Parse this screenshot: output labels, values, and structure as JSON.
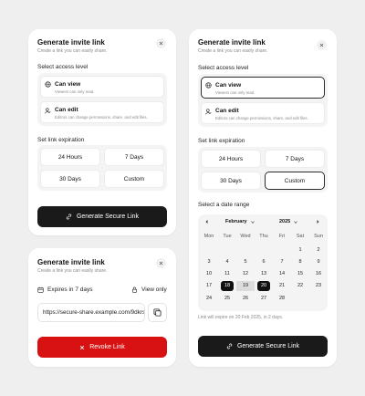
{
  "card1": {
    "title": "Generate invite link",
    "subtitle": "Create a link you can easily share.",
    "access_label": "Select access level",
    "options": [
      {
        "title": "Can view",
        "desc": "Viewers can only read."
      },
      {
        "title": "Can edit",
        "desc": "Editors can change permissions, share, and edit files."
      }
    ],
    "expiration_label": "Set link expiration",
    "durations": [
      "24 Hours",
      "7 Days",
      "30 Days",
      "Custom"
    ],
    "generate_label": "Generate Secure Link"
  },
  "card2": {
    "title": "Generate invite link",
    "subtitle": "Create a link you can easily share.",
    "expires": "Expires in 7 days",
    "permission": "View only",
    "url": "https://secure-share.example.com/9dkrs",
    "revoke_label": "Revoke Link"
  },
  "card3": {
    "title": "Generate invite link",
    "subtitle": "Create a link you can easily share.",
    "access_label": "Select access level",
    "options": [
      {
        "title": "Can view",
        "desc": "Viewers can only read."
      },
      {
        "title": "Can edit",
        "desc": "Editors can change permissions, share, and edit files."
      }
    ],
    "expiration_label": "Set link expiration",
    "durations": [
      "24 Hours",
      "7 Days",
      "30 Days",
      "Custom"
    ],
    "date_range_label": "Select a date range",
    "calendar": {
      "month": "February",
      "year": "2025",
      "weekdays": [
        "Mon",
        "Tue",
        "Wed",
        "Thu",
        "Fri",
        "Sat",
        "Sun"
      ],
      "weeks": [
        [
          "",
          "",
          "",
          "",
          "",
          "1",
          "2"
        ],
        [
          "3",
          "4",
          "5",
          "6",
          "7",
          "8",
          "9"
        ],
        [
          "10",
          "11",
          "12",
          "13",
          "14",
          "15",
          "16"
        ],
        [
          "17",
          "18",
          "19",
          "20",
          "21",
          "22",
          "23"
        ],
        [
          "24",
          "25",
          "26",
          "27",
          "28",
          "",
          ""
        ]
      ],
      "range_start": "18",
      "range_end": "20"
    },
    "expiry_note": "Link will expire on 20 Feb 2025, in 2 days.",
    "generate_label": "Generate Secure Link"
  },
  "colors": {
    "dark": "#1a1a1a",
    "danger": "#d81212",
    "range": "#dcdcdc"
  }
}
